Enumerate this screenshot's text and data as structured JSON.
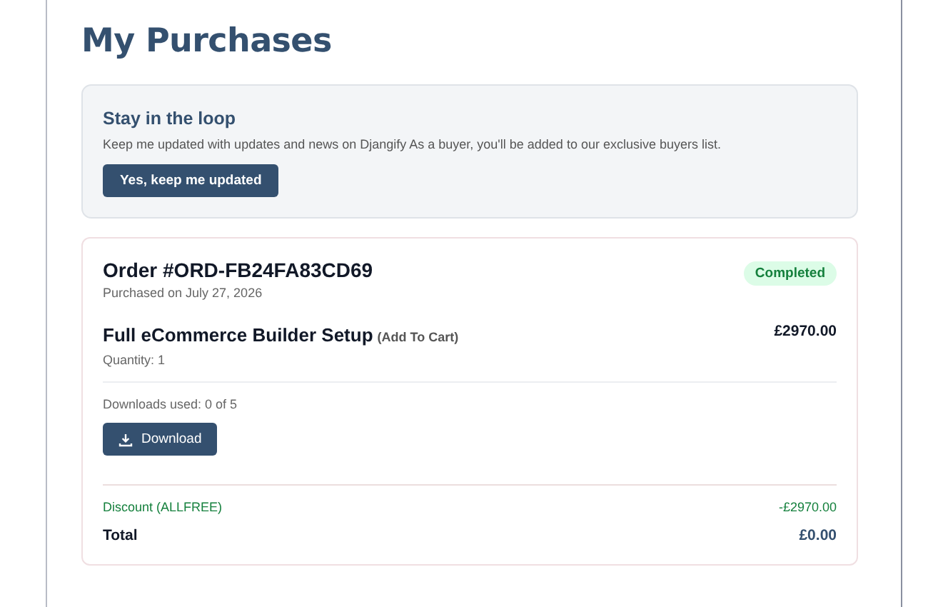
{
  "page_title": "My Purchases",
  "newsletter": {
    "title": "Stay in the loop",
    "text": "Keep me updated with updates and news on Djangify As a buyer, you'll be added to our exclusive buyers list.",
    "button": "Yes, keep me updated"
  },
  "order": {
    "number": "Order #ORD-FB24FA83CD69",
    "date": "Purchased on July 27, 2026",
    "status": {
      "label": "Completed",
      "kind": "success"
    },
    "item": {
      "name": "Full eCommerce Builder Setup",
      "note": "(Add To Cart)",
      "quantity": "Quantity: 1",
      "price": "£2970.00"
    },
    "downloads": "Downloads used: 0 of 5",
    "download_button": "Download",
    "discount": {
      "label": "Discount (ALLFREE)",
      "amount": "-£2970.00"
    },
    "total": {
      "label": "Total",
      "amount": "£0.00"
    }
  }
}
